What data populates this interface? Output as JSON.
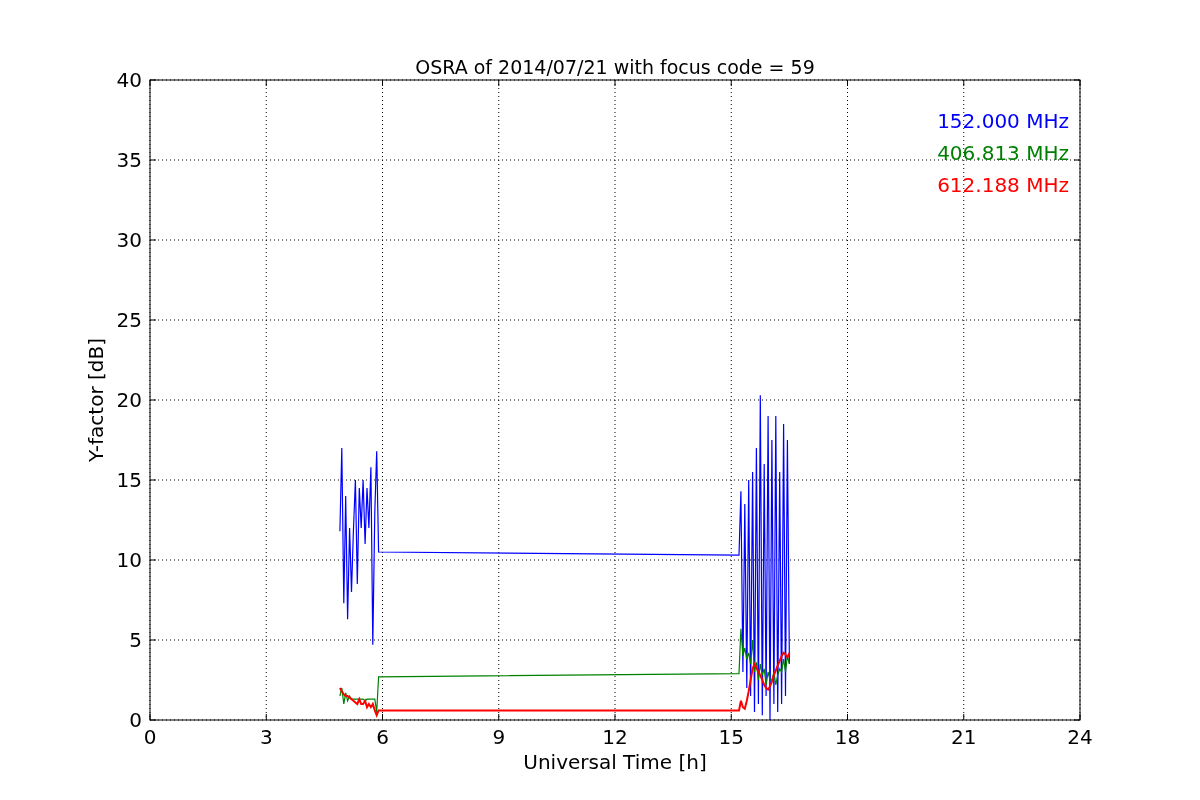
{
  "figure": {
    "chart_data": {
      "type": "line",
      "title": "OSRA of 2014/07/21 with focus code = 59",
      "xlabel": "Universal Time [h]",
      "ylabel": "Y-factor [dB]",
      "x": [
        4.9,
        4.95,
        5.0,
        5.05,
        5.1,
        5.15,
        5.2,
        5.25,
        5.3,
        5.35,
        5.4,
        5.45,
        5.5,
        5.55,
        5.6,
        5.65,
        5.7,
        5.75,
        5.8,
        5.85,
        5.9,
        15.2,
        15.25,
        15.3,
        15.35,
        15.4,
        15.45,
        15.5,
        15.55,
        15.6,
        15.65,
        15.7,
        15.75,
        15.8,
        15.85,
        15.9,
        15.95,
        16.0,
        16.05,
        16.1,
        16.15,
        16.2,
        16.25,
        16.3,
        16.35,
        16.4,
        16.45,
        16.5
      ],
      "series": [
        {
          "name": "152.000 MHz",
          "color": "#0000ff",
          "values": [
            11.8,
            17,
            7.3,
            14,
            6.3,
            12,
            8,
            11.8,
            15,
            8.5,
            14.5,
            12,
            15,
            11,
            14.5,
            12,
            15.8,
            4.7,
            13,
            16.8,
            10.5,
            10.3,
            14.3,
            3,
            13.5,
            2,
            15,
            1.5,
            15.5,
            0.5,
            17,
            1,
            20.3,
            0.3,
            16,
            1.5,
            19,
            0,
            17.5,
            1,
            19,
            0.5,
            15.5,
            1,
            18.5,
            1.5,
            17.5,
            3.5
          ]
        },
        {
          "name": "406.813 MHz",
          "color": "#008000",
          "values": [
            1.5,
            2,
            1,
            1.7,
            1.2,
            1.5,
            1.3,
            1.3,
            1.3,
            1.3,
            1.3,
            1.3,
            1.3,
            1.2,
            1.3,
            1.3,
            1.3,
            1.3,
            1.3,
            0.5,
            2.7,
            2.9,
            5.7,
            4,
            4.5,
            3.8,
            4.2,
            3.5,
            5,
            3,
            3.6,
            2.5,
            3.5,
            2.8,
            3.2,
            2.2,
            3,
            2.5,
            2.5,
            3,
            2.2,
            2.8,
            3.2,
            3,
            3.8,
            3,
            4,
            3.5
          ]
        },
        {
          "name": "612.188 MHz",
          "color": "#ff0000",
          "values": [
            2,
            1.8,
            1.6,
            1.5,
            1.5,
            1.4,
            1.3,
            1.2,
            1.1,
            1,
            1.3,
            1,
            1,
            1.2,
            0.8,
            1,
            0.8,
            1,
            0.6,
            0.3,
            0.6,
            0.6,
            1.2,
            0.8,
            0.7,
            1.2,
            1.8,
            2.5,
            3.2,
            3.5,
            3.3,
            3,
            2.8,
            2.5,
            2.2,
            2,
            1.9,
            2.1,
            2.4,
            2.8,
            3.1,
            3.4,
            3.7,
            4,
            4.2,
            4.1,
            3.9,
            4.2
          ]
        }
      ],
      "grid": true,
      "xlim": [
        0,
        24
      ],
      "ylim": [
        0,
        40
      ],
      "xticks": [
        0,
        3,
        6,
        9,
        12,
        15,
        18,
        21,
        24
      ],
      "yticks": [
        0,
        5,
        10,
        15,
        20,
        25,
        30,
        35,
        40
      ]
    }
  }
}
